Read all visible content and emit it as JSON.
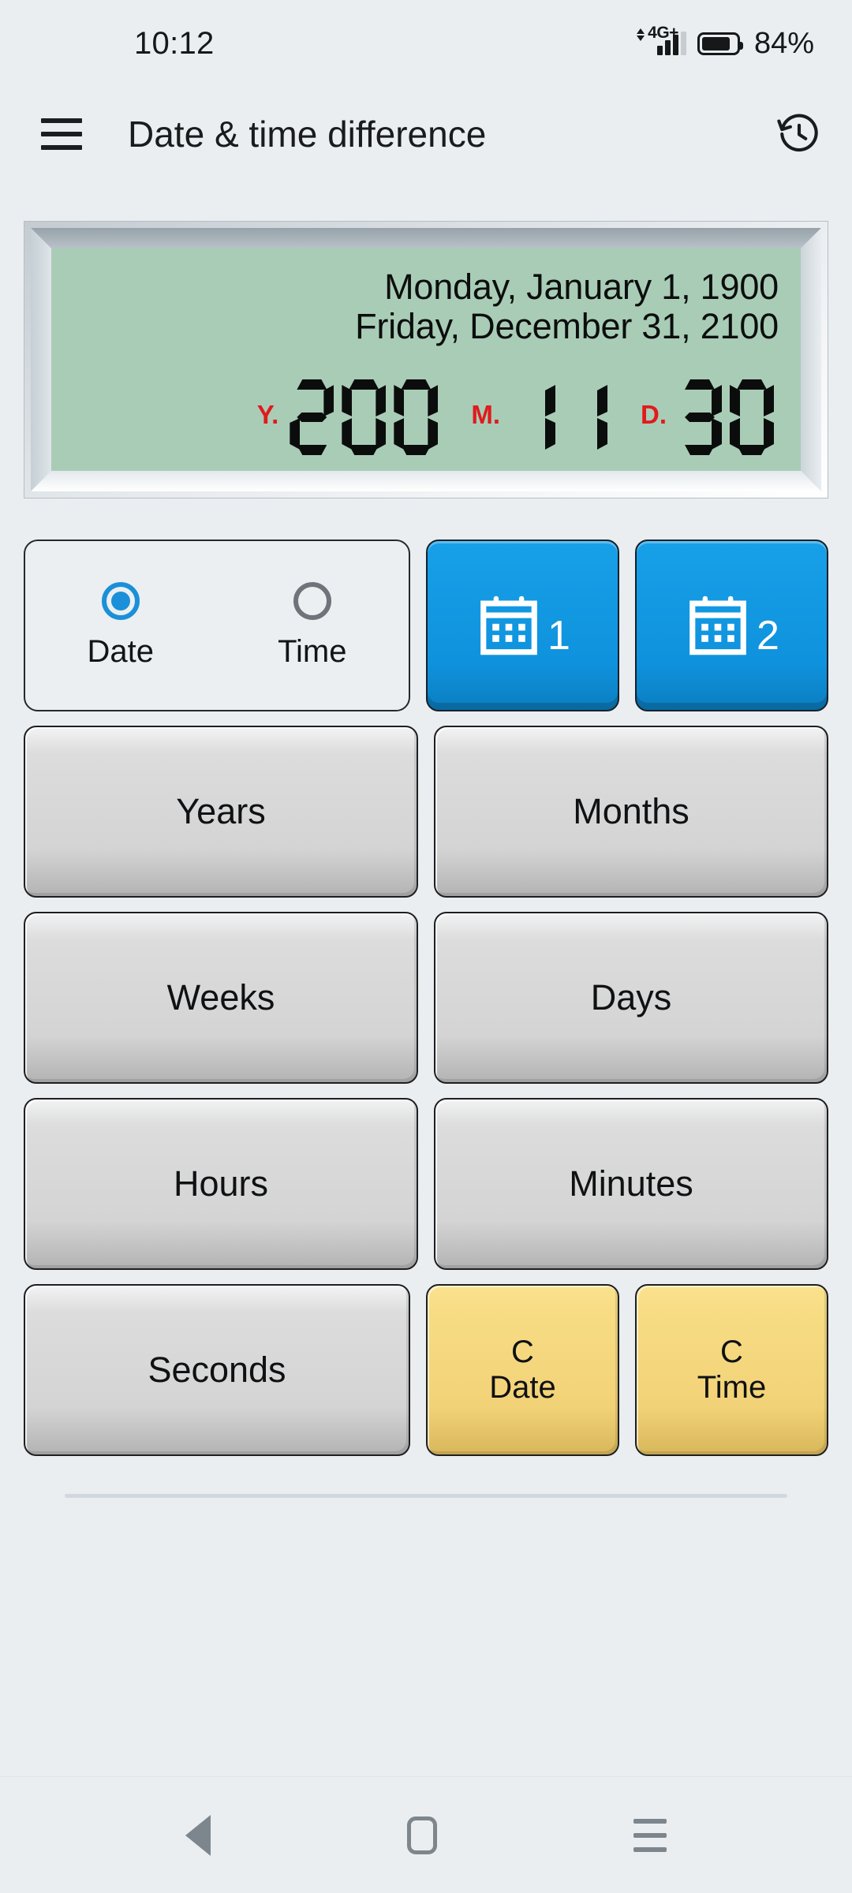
{
  "status_bar": {
    "clock": "10:12",
    "network_label": "4G",
    "network_plus": "+",
    "battery_percent": "84%",
    "battery_level": 84,
    "icons": [
      "signal-bars-icon",
      "battery-icon"
    ]
  },
  "app_bar": {
    "menu_icon": "hamburger-menu-icon",
    "title": "Date & time difference",
    "history_icon": "history-icon"
  },
  "display": {
    "date_line_1": "Monday, January 1, 1900",
    "date_line_2": "Friday, December 31, 2100",
    "segments": [
      {
        "label": "Y.",
        "value": "200"
      },
      {
        "label": "M.",
        "value": "11"
      },
      {
        "label": "D.",
        "value": "30"
      }
    ],
    "lcd_color": "#a9ccb7",
    "label_color": "#e01b1b",
    "digit_color": "#0b0d0c"
  },
  "mode_selector": {
    "options": [
      {
        "label": "Date",
        "selected": true
      },
      {
        "label": "Time",
        "selected": false
      }
    ],
    "accent_color": "#1b90d8"
  },
  "calendar_buttons": [
    {
      "icon": "calendar-icon",
      "number": "1"
    },
    {
      "icon": "calendar-icon",
      "number": "2"
    }
  ],
  "unit_buttons": [
    {
      "label": "Years"
    },
    {
      "label": "Months"
    },
    {
      "label": "Weeks"
    },
    {
      "label": "Days"
    },
    {
      "label": "Hours"
    },
    {
      "label": "Minutes"
    },
    {
      "label": "Seconds"
    }
  ],
  "clear_buttons": [
    {
      "line1": "C",
      "line2": "Date"
    },
    {
      "line1": "C",
      "line2": "Time"
    }
  ],
  "nav_bar": {
    "back": "back-icon",
    "home": "home-icon",
    "recents": "recents-icon"
  }
}
